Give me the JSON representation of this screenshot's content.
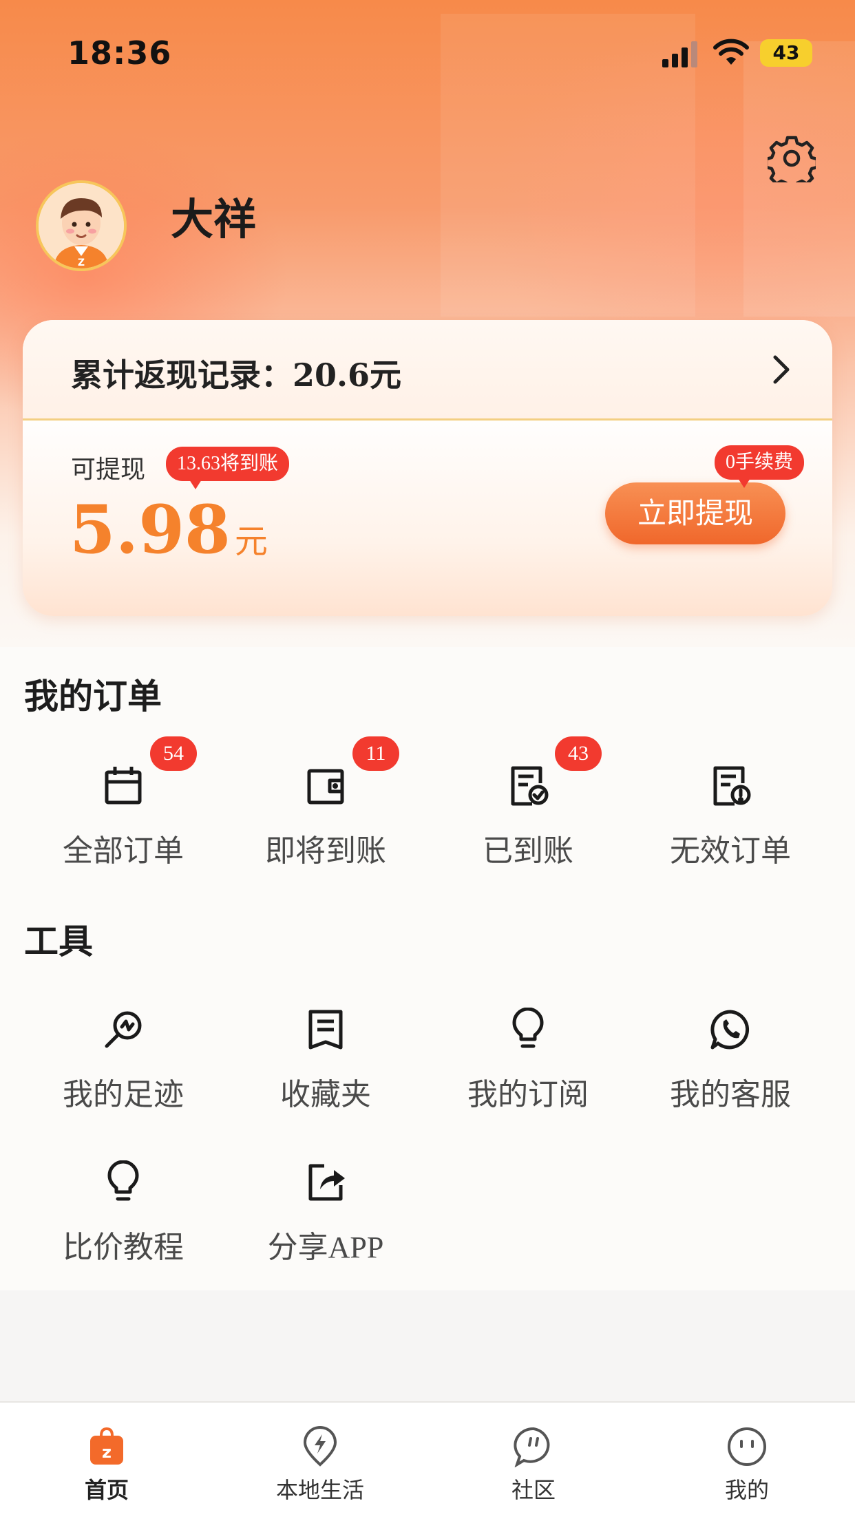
{
  "status_bar": {
    "time": "18:36",
    "battery": "43"
  },
  "profile": {
    "name": "大祥"
  },
  "cashback_card": {
    "cumulative_label": "累计返现记录：20.6元",
    "withdrawable_label": "可提现",
    "pending_tip": "13.63将到账",
    "amount": "5.98",
    "unit": "元",
    "fee_tip": "0手续费",
    "withdraw_button": "立即提现"
  },
  "orders": {
    "title": "我的订单",
    "items": [
      {
        "label": "全部订单",
        "badge": "54",
        "icon": "calendar-icon"
      },
      {
        "label": "即将到账",
        "badge": "11",
        "icon": "wallet-icon"
      },
      {
        "label": "已到账",
        "badge": "43",
        "icon": "receipt-check-icon"
      },
      {
        "label": "无效订单",
        "badge": "",
        "icon": "receipt-alert-icon"
      }
    ]
  },
  "tools": {
    "title": "工具",
    "items": [
      {
        "label": "我的足迹",
        "icon": "footprint-search-icon"
      },
      {
        "label": "收藏夹",
        "icon": "bookmark-icon"
      },
      {
        "label": "我的订阅",
        "icon": "lightbulb-icon"
      },
      {
        "label": "我的客服",
        "icon": "phone-chat-icon"
      },
      {
        "label": "比价教程",
        "icon": "lightbulb-icon"
      },
      {
        "label": "分享APP",
        "icon": "share-icon"
      }
    ]
  },
  "tabbar": {
    "items": [
      {
        "label": "首页",
        "icon": "shopping-bag-icon",
        "active": true
      },
      {
        "label": "本地生活",
        "icon": "location-bolt-icon",
        "active": false
      },
      {
        "label": "社区",
        "icon": "chat-bubble-icon",
        "active": false
      },
      {
        "label": "我的",
        "icon": "smiley-icon",
        "active": false
      }
    ]
  },
  "colors": {
    "accent": "#f5822c",
    "badge": "#f23a2f",
    "button": "#f0672b"
  }
}
